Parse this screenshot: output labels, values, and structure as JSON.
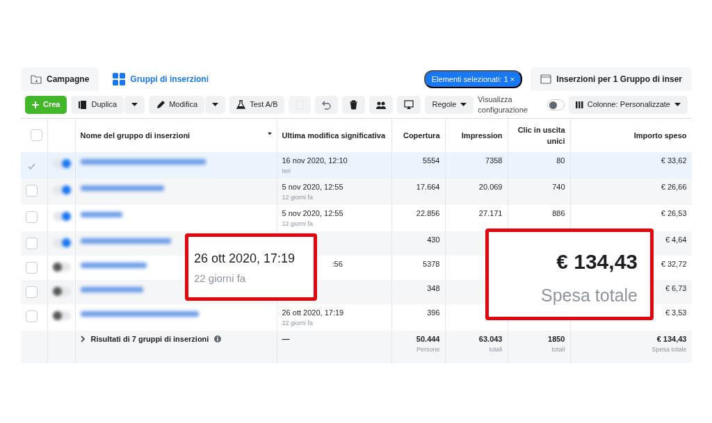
{
  "tabs": [
    {
      "label": "Campagne",
      "selected": false
    },
    {
      "label": "Gruppi di inserzioni",
      "selected": true
    },
    {
      "label": "Inserzioni per 1 Gruppo di inser",
      "selected": false
    }
  ],
  "selection_badge": {
    "label": "Elementi selezionati: 1",
    "close": "×"
  },
  "toolbar": [
    {
      "kind": "create",
      "label": "Crea"
    },
    {
      "kind": "split",
      "label": "Duplica"
    },
    {
      "kind": "split",
      "label": "Modifica"
    },
    {
      "kind": "button",
      "label": "Test A/B"
    },
    {
      "kind": "icon",
      "disabled": true
    },
    {
      "kind": "icon",
      "disabled": false
    },
    {
      "kind": "icon",
      "disabled": false
    },
    {
      "kind": "icon",
      "disabled": false
    },
    {
      "kind": "icon",
      "disabled": false
    },
    {
      "kind": "menu",
      "label": "Regole"
    },
    {
      "kind": "text",
      "label": "Visualizza configurazione"
    },
    {
      "kind": "toggle",
      "on": false
    },
    {
      "kind": "menu",
      "label": "Colonne: Personalizzate"
    }
  ],
  "table": {
    "select_all": {
      "checked": false
    },
    "columns": [
      "Nome del gruppo di inserzioni",
      "Ultima modifica significativa",
      "Copertura",
      "Impression",
      "Clic in uscita unici",
      "Importo speso"
    ],
    "rows": [
      {
        "selected": true,
        "on": true,
        "date": "16 nov 2020, 12:10",
        "ago": "Ieri",
        "reach": "5554",
        "impressions": "7358",
        "clicks": "80",
        "spent": "€ 33,62"
      },
      {
        "selected": false,
        "on": true,
        "date": "5 nov 2020, 12:55",
        "ago": "12 giorni fa",
        "reach": "17.664",
        "impressions": "20.069",
        "clicks": "740",
        "spent": "€ 26,66"
      },
      {
        "selected": false,
        "on": true,
        "date": "5 nov 2020, 12:55",
        "ago": "12 giorni fa",
        "reach": "22.856",
        "impressions": "27.171",
        "clicks": "886",
        "spent": "€ 26,53"
      },
      {
        "selected": false,
        "on": true,
        "reach": "430",
        "spent": "€ 4,64"
      },
      {
        "selected": false,
        "on": false,
        "date": ":56",
        "date_cut": true,
        "reach": "5378",
        "spent": "€ 32,72"
      },
      {
        "selected": false,
        "on": false,
        "reach": "348",
        "spent": "€ 6,73"
      },
      {
        "selected": false,
        "on": false,
        "date": "26 ott 2020, 17:19",
        "ago": "22 giorni fa",
        "reach": "396",
        "spent": "€ 3,53"
      }
    ],
    "footer": {
      "label": "Risultati di 7 gruppi di inserzioni",
      "date": "—",
      "reach": "50.444",
      "reach_unit": "Persone",
      "impressions": "63.043",
      "impressions_unit": "totali",
      "clicks": "1850",
      "clicks_unit": "totali",
      "spent": "€ 134,43",
      "spent_unit": "Spesa totale"
    }
  },
  "callouts": [
    {
      "kind": "date",
      "value": "26 ott 2020, 17:19",
      "caption": "22 giorni fa"
    },
    {
      "kind": "total",
      "value": "€ 134,43",
      "caption": "Spesa totale"
    }
  ]
}
